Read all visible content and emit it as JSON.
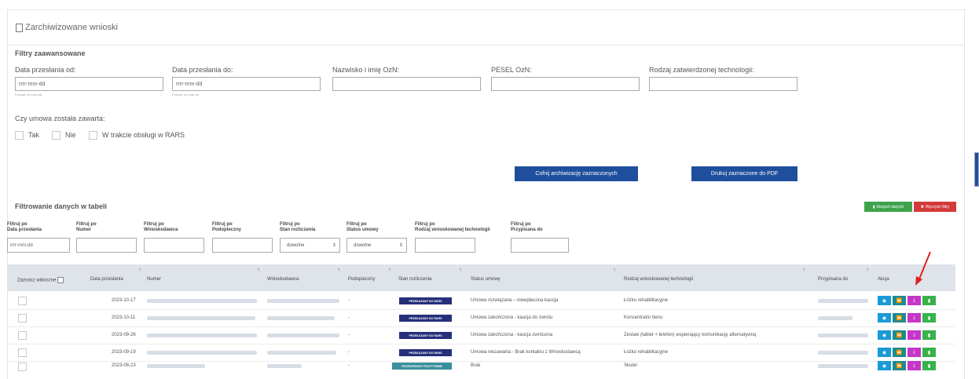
{
  "panel": {
    "title": "Zarchiwizowane wnioski"
  },
  "advanced_filters": {
    "title": "Filtry zaawansowane",
    "fields": [
      {
        "label": "Data przesłania od:",
        "placeholder": "rrrr-mm-dd",
        "hint": "Format: rrrr-mm-dd"
      },
      {
        "label": "Data przesłania do:",
        "placeholder": "rrrr-mm-dd",
        "hint": "Format: rrrr-mm-dd"
      },
      {
        "label": "Nazwisko i imię OzN:",
        "placeholder": ""
      },
      {
        "label": "PESEL OzN:",
        "placeholder": ""
      },
      {
        "label": "Rodzaj zatwierdzonej technologii:",
        "placeholder": ""
      }
    ],
    "contract_question": "Czy umowa została zawarta:",
    "contract_options": [
      "Tak",
      "Nie",
      "W trakcie obsługi w RARS"
    ],
    "buttons": {
      "unarchive": "Cofnij archiwizację zaznaczonych",
      "print_pdf": "Drukuj zaznaczone do PDF"
    }
  },
  "table_filters": {
    "title": "Filtrowanie danych w tabeli",
    "export_label": "Eksport danych",
    "clear_label": "Wyczyść filtry",
    "filters": [
      {
        "label1": "Filtruj po",
        "label2": "Data przesłania",
        "placeholder": "rrrr-mm-dd"
      },
      {
        "label1": "Filtruj po",
        "label2": "Numer",
        "placeholder": ""
      },
      {
        "label1": "Filtruj po",
        "label2": "Wnioskodawca",
        "placeholder": ""
      },
      {
        "label1": "Filtruj po",
        "label2": "Podopieczny",
        "placeholder": ""
      },
      {
        "label1": "Filtruj po",
        "label2": "Stan rozliczenia",
        "value": "dowolne"
      },
      {
        "label1": "Filtruj po",
        "label2": "Status umowy",
        "value": "dowolne"
      },
      {
        "label1": "Filtruj po",
        "label2": "Rodzaj wnioskowanej technologii",
        "placeholder": ""
      },
      {
        "label1": "Filtruj po",
        "label2": "Przypisana do",
        "placeholder": ""
      }
    ]
  },
  "table": {
    "columns": [
      "Zaznacz widoczne",
      "Data przesłania",
      "Numer",
      "Wnioskodawca",
      "Podopieczny",
      "Stan rozliczenia",
      "Status umowy",
      "Rodzaj wnioskowanej technologii",
      "Przypisana do",
      "Akcja"
    ],
    "rows": [
      {
        "date": "2023-10-17",
        "podopieczny": "-",
        "stan": "PRZEKAZANY DO RARS",
        "status": "Umowa rozwiązana – niewpłacona kaucja",
        "technologia": "Łóżko rehabilitacyjne"
      },
      {
        "date": "2023-10-11",
        "podopieczny": "-",
        "stan": "PRZEKAZANY DO RARS",
        "status": "Umowa zakończona - kaucja do zwrotu",
        "technologia": "Koncentrator tlenu"
      },
      {
        "date": "2023-09-26",
        "podopieczny": "-",
        "stan": "PRZEKAZANY DO RARS",
        "status": "Umowa zakończona - kaucja zwrócona",
        "technologia": "Zestaw (tablet + telefon) wspierający komunikację alternatywną"
      },
      {
        "date": "2023-09-19",
        "podopieczny": "-",
        "stan": "PRZEKAZANY DO RARS",
        "status": "Umowa niezawarta - Brak kontaktu z Wnioskodawcą",
        "technologia": "Łóżko rehabilitacyjne"
      },
      {
        "date": "2023-08-23",
        "podopieczny": "-",
        "stan": "ROZPATRZONY POZYTYWNIE",
        "status": "Brak",
        "technologia": "Skuter"
      }
    ]
  },
  "colors": {
    "primary": "#1f4f9c",
    "badge_navy": "#252f7a",
    "badge_teal": "#3a8f9c",
    "act_blue": "#1a9ad6",
    "act_teal": "#1c8a92",
    "act_magenta": "#c536c9",
    "act_green": "#38b24a",
    "annotation_red": "#e02020"
  },
  "icons": {
    "view": "eye-icon",
    "back": "rewind-icon",
    "download": "download-icon",
    "doc": "document-icon"
  }
}
